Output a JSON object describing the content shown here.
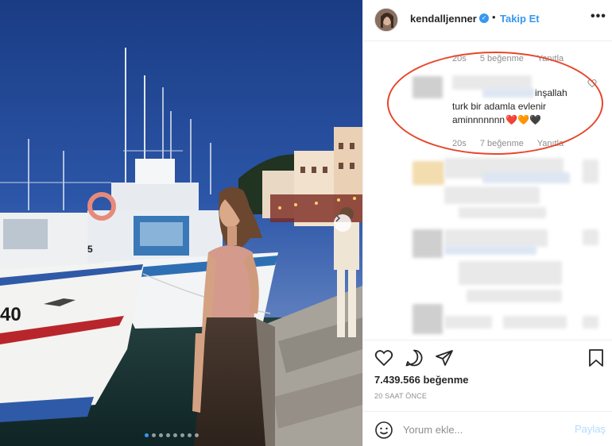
{
  "post": {
    "username": "kendalljenner",
    "verified_symbol": "✓",
    "bullet": "•",
    "follow_label": "Takip Et",
    "more_symbol": "•••"
  },
  "photo": {
    "boat_number": "40",
    "boat_number_partial": "5"
  },
  "comments": [
    {
      "meta_time": "20s",
      "meta_likes": "5 beğenme",
      "meta_reply": "Yanıtla"
    },
    {
      "text_line1": "inşallah",
      "text_line2": "turk bir adamla evlenir",
      "text_line3": "aminnnnnnn",
      "emojis": "❤️🧡🖤",
      "meta_time": "20s",
      "meta_likes": "7 beğenme",
      "meta_reply": "Yanıtla",
      "highlight_color": "#e8462b"
    }
  ],
  "actions": {
    "likes_text": "7.439.566 beğenme",
    "time_text": "20 SAAT ÖNCE"
  },
  "comment_box": {
    "placeholder": "Yorum ekle...",
    "post_label": "Paylaş"
  },
  "colors": {
    "accent": "#3897f0",
    "muted": "#8e8e8e",
    "text": "#262626"
  }
}
